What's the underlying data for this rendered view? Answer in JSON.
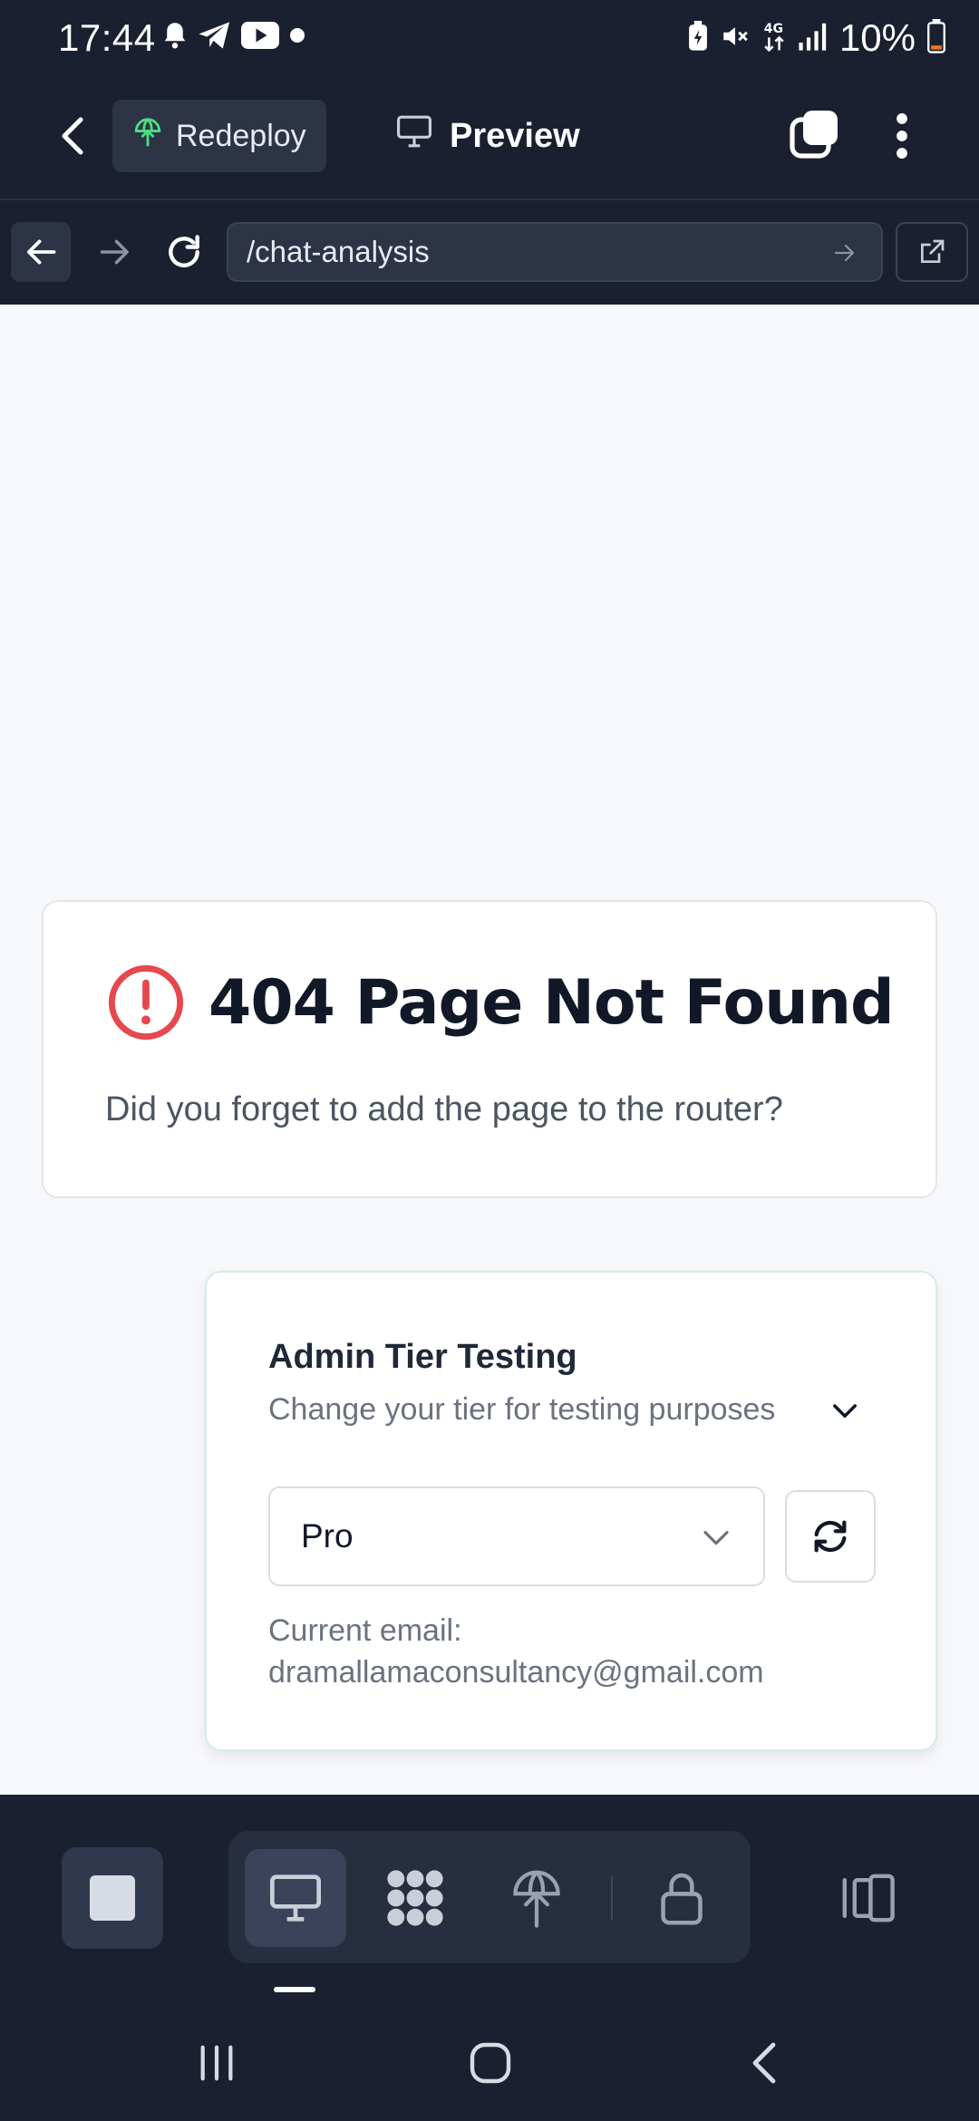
{
  "status_bar": {
    "time": "17:44",
    "battery": "10%"
  },
  "header": {
    "redeploy_label": "Redeploy",
    "preview_label": "Preview"
  },
  "url_bar": {
    "path": "/chat-analysis"
  },
  "error_card": {
    "title": "404 Page Not Found",
    "description": "Did you forget to add the page to the router?"
  },
  "tier_card": {
    "title": "Admin Tier Testing",
    "subtitle": "Change your tier for testing purposes",
    "selected_tier": "Pro",
    "email_label": "Current email:",
    "email": "dramallamaconsultancy@gmail.com"
  },
  "colors": {
    "accent_green": "#4ade80",
    "alert_red": "#e5484d",
    "dark_bg": "#1b2030"
  }
}
